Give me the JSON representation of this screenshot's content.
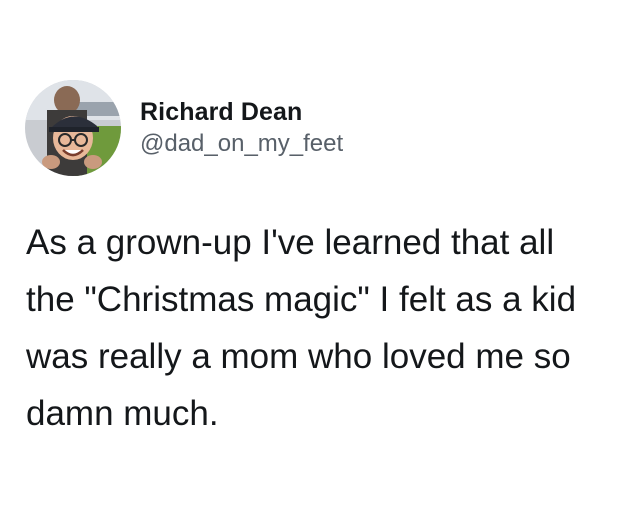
{
  "tweet": {
    "author": {
      "display_name": "Richard Dean",
      "handle": "@dad_on_my_feet",
      "avatar_icon": "profile-photo"
    },
    "text_lines": [
      "As a grown-up I've learned that all",
      "the \"Christmas magic\" I felt as a kid",
      "was really a mom who loved me so",
      "damn much."
    ]
  },
  "colors": {
    "text": "#14171a",
    "handle": "#586069",
    "background": "#ffffff"
  }
}
